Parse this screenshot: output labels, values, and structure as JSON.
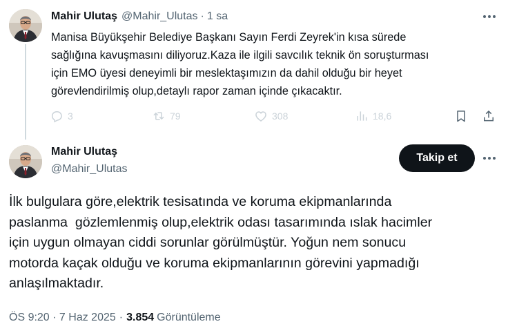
{
  "parent_tweet": {
    "author_name": "Mahir Ulutaş",
    "author_handle": "@Mahir_Ulutas",
    "separator": "·",
    "time_ago": "1 sa",
    "text": "Manisa Büyükşehir Belediye Başkanı Sayın Ferdi Zeyrek'in kısa sürede\nsağlığına kavuşmasını diliyoruz.Kaza ile ilgili savcılık teknik ön soruşturması\niçin EMO üyesi deneyimli bir meslektaşımızın da dahil olduğu bir heyet\ngörevlendirilmiş olup,detaylı rapor zaman içinde çıkacaktır.",
    "actions": {
      "reply_count": "3",
      "retweet_count": "79",
      "like_count": "308",
      "view_count": "18,6"
    },
    "icons": [
      "reply-icon",
      "retweet-icon",
      "like-icon",
      "views-icon",
      "bookmark-icon",
      "share-icon",
      "more-icon"
    ]
  },
  "main_tweet": {
    "author_name": "Mahir Ulutaş",
    "author_handle": "@Mahir_Ulutas",
    "follow_label": "Takip et",
    "text": "İlk bulgulara göre,elektrik tesisatında ve koruma ekipmanlarında\npaslanma  gözlemlenmiş olup,elektrik odası tasarımında ıslak hacimler\niçin uygun olmayan ciddi sorunlar görülmüştür. Yoğun nem sonucu\nmotorda kaçak olduğu ve koruma ekipmanlarının görevini yapmadığı\nanlaşılmaktadır.",
    "timestamp": "ÖS 9:20 · 7 Haz 2025",
    "separator": "·",
    "views_count": "3.854",
    "views_label": "Görüntüleme"
  },
  "colors": {
    "text_primary": "#0f1419",
    "text_secondary": "#536471",
    "muted_action": "#cbd3d9",
    "thread_line": "#cfd9de",
    "follow_button_bg": "#0f1419",
    "follow_button_text": "#ffffff"
  }
}
